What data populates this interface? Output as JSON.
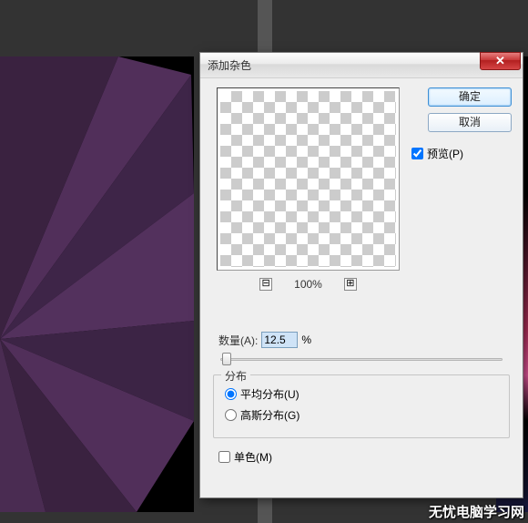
{
  "dialog": {
    "title": "添加杂色",
    "close_glyph": "✕",
    "ok_label": "确定",
    "cancel_label": "取消",
    "preview_checkbox_label": "预览(P)",
    "preview_checked": true,
    "zoom": {
      "level": "100%",
      "minus": "⊟",
      "plus": "⊞"
    },
    "amount": {
      "label": "数量(A):",
      "value": "12.5",
      "unit": "%"
    },
    "distribution": {
      "legend": "分布",
      "uniform_label": "平均分布(U)",
      "gaussian_label": "高斯分布(G)",
      "selected": "uniform"
    },
    "monochrome": {
      "label": "单色(M)",
      "checked": false
    }
  },
  "watermark": "无忧电脑学习网"
}
